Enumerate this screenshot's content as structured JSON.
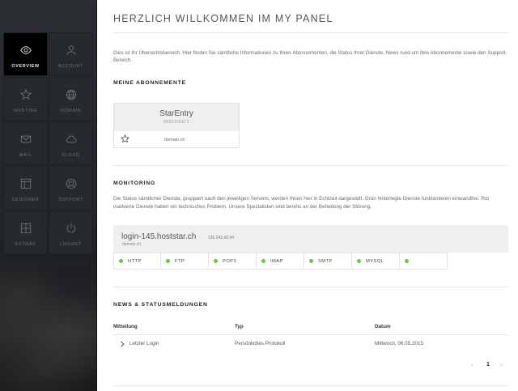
{
  "sidebar": {
    "items": [
      {
        "label": "OVERVIEW",
        "icon": "eye-icon"
      },
      {
        "label": "ACCOUNT",
        "icon": "user-icon"
      },
      {
        "label": "HOSTING",
        "icon": "star-icon"
      },
      {
        "label": "DOMAIN",
        "icon": "globe-icon"
      },
      {
        "label": "MAIL",
        "icon": "mail-icon"
      },
      {
        "label": "CLOUD",
        "icon": "cloud-icon"
      },
      {
        "label": "DESIGNER",
        "icon": "layout-icon"
      },
      {
        "label": "SUPPORT",
        "icon": "lifebuoy-icon"
      },
      {
        "label": "EXTRAS",
        "icon": "plus-square-icon"
      },
      {
        "label": "LOGOUT",
        "icon": "power-icon"
      }
    ],
    "active_item": "OVERVIEW"
  },
  "page": {
    "title": "HERZLICH WILLKOMMEN IM MY PANEL",
    "intro": "Dies ist Ihr Übersichtsbereich. Hier finden Sie sämtliche Informationen zu Ihren Abonnementen, die Status Ihrer Dienste, News rund um Ihre Abonnemente sowie den Support-Bereich."
  },
  "subscriptions": {
    "heading": "MEINE ABONNEMENTE",
    "card": {
      "name": "StarEntry",
      "number": "9900100972",
      "domain": "domain.ch"
    }
  },
  "monitoring": {
    "heading": "MONITORING",
    "description": "Die Status sämtlicher Dienste, gruppiert nach den jeweiligen Servern, werden Ihnen hier in Echtzeit dargestellt. Grün hinterlegte Dienste funktionieren einwandfrei. Rot markierte Dienste haben ein technisches Problem. Unsere Spezialisten sind bereits an der Behebung der Störung.",
    "server": {
      "name": "login-145.hoststar.ch",
      "ip": "136.243.42.94",
      "domain": "domain.ch"
    },
    "services": [
      {
        "label": "HTTP",
        "status": "ok"
      },
      {
        "label": "FTP",
        "status": "ok"
      },
      {
        "label": "POP3",
        "status": "ok"
      },
      {
        "label": "IMAP",
        "status": "ok"
      },
      {
        "label": "SMTP",
        "status": "ok"
      },
      {
        "label": "MYSQL",
        "status": "ok"
      },
      {
        "label": "",
        "status": "ok"
      }
    ],
    "status_color": "#6dc34a"
  },
  "news": {
    "heading": "NEWS & STATUSMELDUNGEN",
    "columns": [
      "Mitteilung",
      "Typ",
      "Datum"
    ],
    "rows": [
      {
        "message": "Letzter Login",
        "type": "Persönliches Protokoll",
        "date": "Mittwoch, 06.05.2015"
      }
    ],
    "pagination": {
      "prev": "‹",
      "current": "1",
      "next": "›"
    }
  }
}
